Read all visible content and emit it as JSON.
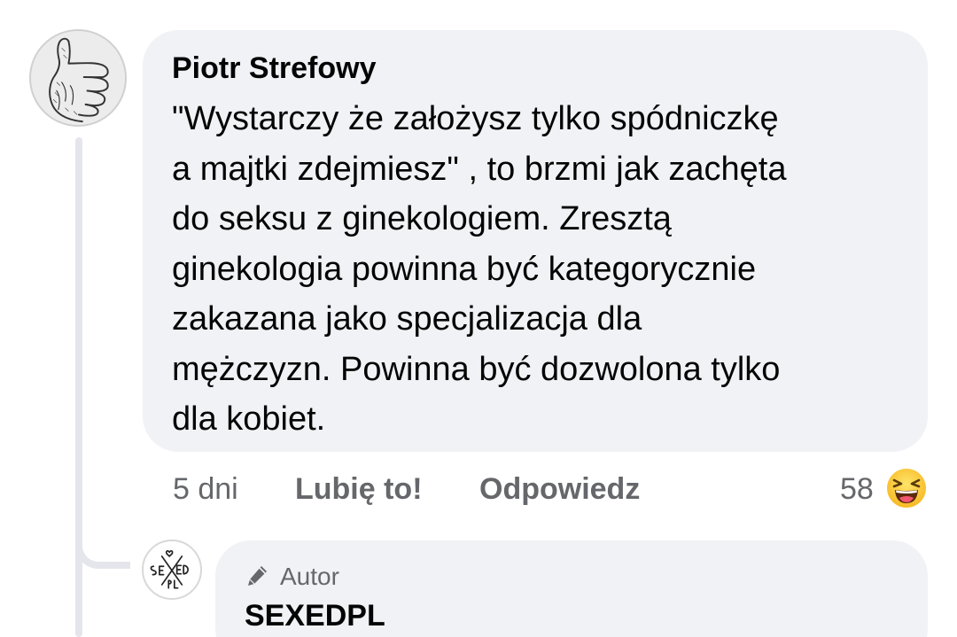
{
  "comment": {
    "author": "Piotr Strefowy",
    "text_lines": [
      "\"Wystarczy że założysz tylko spódniczkę",
      "a majtki zdejmiesz\" , to brzmi jak zachęta",
      "do seksu z ginekologiem. Zresztą",
      "ginekologia powinna być kategorycznie",
      "zakazana jako specjalizacja dla",
      "mężczyzn. Powinna być dozwolona tylko",
      "dla kobiet."
    ],
    "time": "5 dni",
    "like_label": "Lubię to!",
    "reply_label": "Odpowiedz",
    "reaction_count": "58",
    "reaction_icon": "laughing-emoji-icon",
    "avatar_icon": "thumbs-up-icon"
  },
  "reply": {
    "badge_label": "Autor",
    "badge_icon": "pencil-icon",
    "author": "SEXEDPL",
    "avatar_icon": "sexedpl-logo",
    "avatar_logo_text": "SEXEDPL"
  },
  "colors": {
    "bubble": "#f0f2f5",
    "text": "#050505",
    "secondary_text": "#65676b",
    "thread_line": "#e4e6eb"
  }
}
